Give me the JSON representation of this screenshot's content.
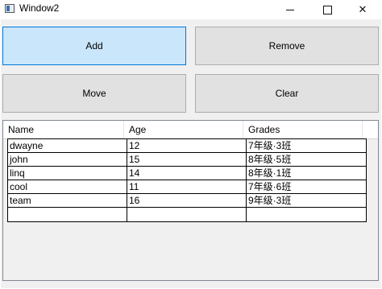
{
  "window": {
    "title": "Window2"
  },
  "buttons": {
    "add": "Add",
    "remove": "Remove",
    "move": "Move",
    "clear": "Clear"
  },
  "grid": {
    "columns": [
      "Name",
      "Age",
      "Grades"
    ],
    "rows": [
      [
        "dwayne",
        "12",
        "7年级·3班"
      ],
      [
        "john",
        "15",
        "8年级·5班"
      ],
      [
        "linq",
        "14",
        "8年级·1班"
      ],
      [
        "cool",
        "11",
        "7年级·6班"
      ],
      [
        "team",
        "16",
        "9年级·3班"
      ]
    ]
  },
  "icons": {
    "app": "window-app-icon",
    "minimize": "minimize-icon",
    "maximize": "maximize-icon",
    "close": "close-icon"
  },
  "colors": {
    "add_hover_bg": "#c9e6fb",
    "add_hover_border": "#0078d7",
    "button_bg": "#e1e1e1"
  }
}
